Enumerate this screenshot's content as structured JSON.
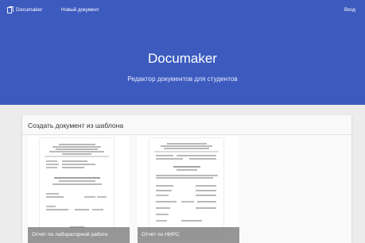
{
  "nav": {
    "brand": "Documaker",
    "new_document": "Новый документ",
    "login": "Вход"
  },
  "hero": {
    "title": "Documaker",
    "subtitle": "Редактор документов для студентов"
  },
  "templates": {
    "heading": "Создать документ из шаблона",
    "items": [
      {
        "label": "Отчёт по лабораторной работе",
        "thumbnail": "document-preview"
      },
      {
        "label": "Отчёт по НИРС",
        "thumbnail": "document-preview"
      }
    ]
  },
  "colors": {
    "header_bg": "#3d5bbf",
    "page_bg": "#ececec",
    "caption_overlay": "#787878"
  },
  "icons": {
    "brand": "document-copy-icon"
  }
}
